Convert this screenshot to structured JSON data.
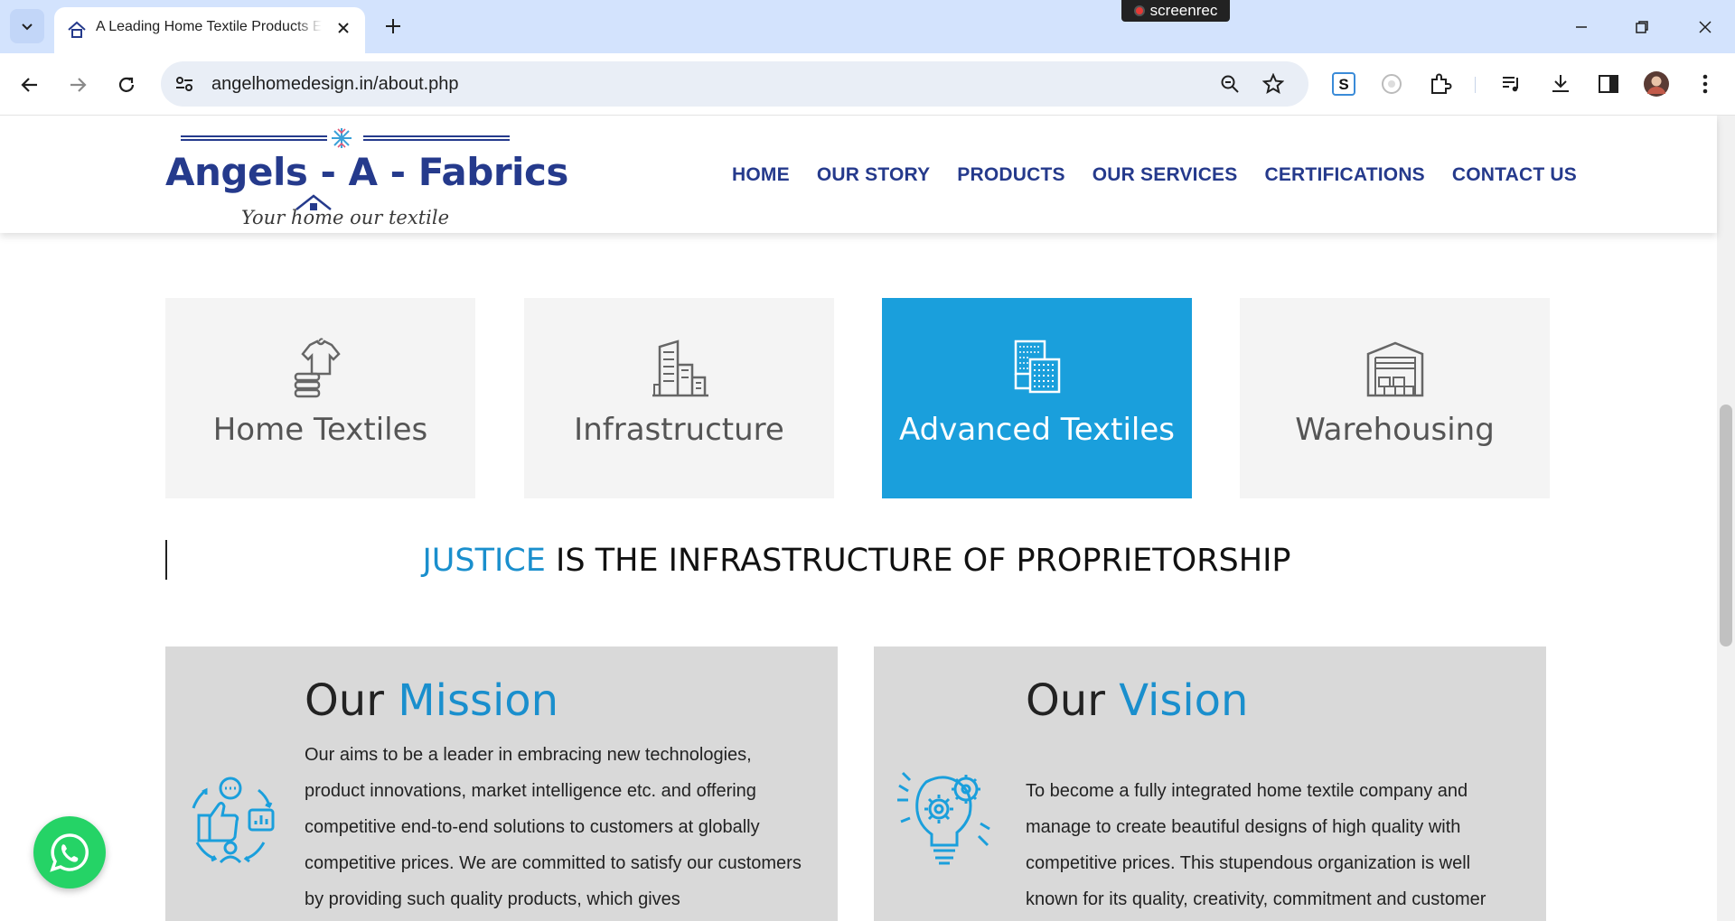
{
  "browser": {
    "tab_title": "A Leading Home Textile Products Exporter",
    "url": "angelhomedesign.in/about.php",
    "recorder_label": "screenrec"
  },
  "site": {
    "logo_title": "Angels - A - Fabrics",
    "logo_tagline": "Your home our textile",
    "nav": [
      "HOME",
      "OUR STORY",
      "PRODUCTS",
      "OUR SERVICES",
      "CERTIFICATIONS",
      "CONTACT US"
    ],
    "brand_color": "#253a8c",
    "accent_color": "#1a9fdc"
  },
  "services": [
    {
      "label": "Home Textiles",
      "icon": "tshirt-stack-icon",
      "active": false
    },
    {
      "label": "Infrastructure",
      "icon": "buildings-icon",
      "active": false
    },
    {
      "label": "Advanced Textiles",
      "icon": "fabric-swatch-icon",
      "active": true
    },
    {
      "label": "Warehousing",
      "icon": "warehouse-icon",
      "active": false
    }
  ],
  "headline": {
    "accent": "JUSTICE",
    "rest": " IS THE INFRASTRUCTURE OF PROPRIETORSHIP"
  },
  "mission": {
    "title_prefix": "Our ",
    "title_accent": "Mission",
    "text": "Our aims to be a leader in embracing new technologies, product innovations, market intelligence etc. and offering competitive end-to-end solutions to customers at globally competitive prices. We are committed to satisfy our customers by providing such quality products, which gives",
    "icon": "customer-feedback-cycle-icon"
  },
  "vision": {
    "title_prefix": "Our ",
    "title_accent": "Vision",
    "text": "To become a fully integrated home textile company and manage to create beautiful designs of high quality with competitive prices. This stupendous organization is well known for its quality, creativity, commitment and customer",
    "icon": "idea-gear-icon"
  }
}
